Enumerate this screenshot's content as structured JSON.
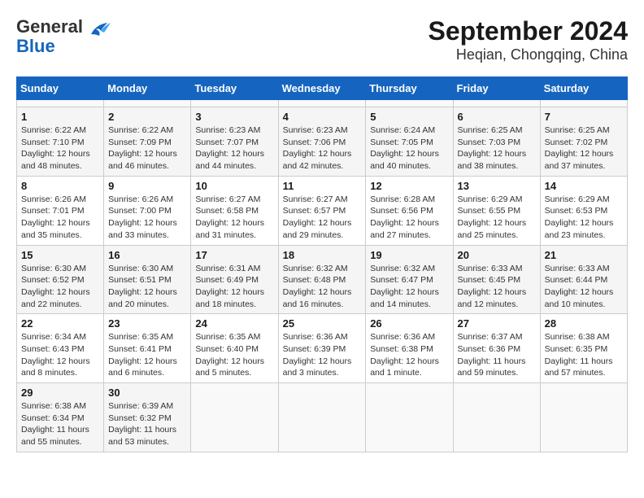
{
  "header": {
    "logo_general": "General",
    "logo_blue": "Blue",
    "title": "September 2024",
    "subtitle": "Heqian, Chongqing, China"
  },
  "calendar": {
    "days_of_week": [
      "Sunday",
      "Monday",
      "Tuesday",
      "Wednesday",
      "Thursday",
      "Friday",
      "Saturday"
    ],
    "weeks": [
      [
        {
          "day": "",
          "detail": ""
        },
        {
          "day": "",
          "detail": ""
        },
        {
          "day": "",
          "detail": ""
        },
        {
          "day": "",
          "detail": ""
        },
        {
          "day": "",
          "detail": ""
        },
        {
          "day": "",
          "detail": ""
        },
        {
          "day": "",
          "detail": ""
        }
      ],
      [
        {
          "day": "1",
          "detail": "Sunrise: 6:22 AM\nSunset: 7:10 PM\nDaylight: 12 hours\nand 48 minutes."
        },
        {
          "day": "2",
          "detail": "Sunrise: 6:22 AM\nSunset: 7:09 PM\nDaylight: 12 hours\nand 46 minutes."
        },
        {
          "day": "3",
          "detail": "Sunrise: 6:23 AM\nSunset: 7:07 PM\nDaylight: 12 hours\nand 44 minutes."
        },
        {
          "day": "4",
          "detail": "Sunrise: 6:23 AM\nSunset: 7:06 PM\nDaylight: 12 hours\nand 42 minutes."
        },
        {
          "day": "5",
          "detail": "Sunrise: 6:24 AM\nSunset: 7:05 PM\nDaylight: 12 hours\nand 40 minutes."
        },
        {
          "day": "6",
          "detail": "Sunrise: 6:25 AM\nSunset: 7:03 PM\nDaylight: 12 hours\nand 38 minutes."
        },
        {
          "day": "7",
          "detail": "Sunrise: 6:25 AM\nSunset: 7:02 PM\nDaylight: 12 hours\nand 37 minutes."
        }
      ],
      [
        {
          "day": "8",
          "detail": "Sunrise: 6:26 AM\nSunset: 7:01 PM\nDaylight: 12 hours\nand 35 minutes."
        },
        {
          "day": "9",
          "detail": "Sunrise: 6:26 AM\nSunset: 7:00 PM\nDaylight: 12 hours\nand 33 minutes."
        },
        {
          "day": "10",
          "detail": "Sunrise: 6:27 AM\nSunset: 6:58 PM\nDaylight: 12 hours\nand 31 minutes."
        },
        {
          "day": "11",
          "detail": "Sunrise: 6:27 AM\nSunset: 6:57 PM\nDaylight: 12 hours\nand 29 minutes."
        },
        {
          "day": "12",
          "detail": "Sunrise: 6:28 AM\nSunset: 6:56 PM\nDaylight: 12 hours\nand 27 minutes."
        },
        {
          "day": "13",
          "detail": "Sunrise: 6:29 AM\nSunset: 6:55 PM\nDaylight: 12 hours\nand 25 minutes."
        },
        {
          "day": "14",
          "detail": "Sunrise: 6:29 AM\nSunset: 6:53 PM\nDaylight: 12 hours\nand 23 minutes."
        }
      ],
      [
        {
          "day": "15",
          "detail": "Sunrise: 6:30 AM\nSunset: 6:52 PM\nDaylight: 12 hours\nand 22 minutes."
        },
        {
          "day": "16",
          "detail": "Sunrise: 6:30 AM\nSunset: 6:51 PM\nDaylight: 12 hours\nand 20 minutes."
        },
        {
          "day": "17",
          "detail": "Sunrise: 6:31 AM\nSunset: 6:49 PM\nDaylight: 12 hours\nand 18 minutes."
        },
        {
          "day": "18",
          "detail": "Sunrise: 6:32 AM\nSunset: 6:48 PM\nDaylight: 12 hours\nand 16 minutes."
        },
        {
          "day": "19",
          "detail": "Sunrise: 6:32 AM\nSunset: 6:47 PM\nDaylight: 12 hours\nand 14 minutes."
        },
        {
          "day": "20",
          "detail": "Sunrise: 6:33 AM\nSunset: 6:45 PM\nDaylight: 12 hours\nand 12 minutes."
        },
        {
          "day": "21",
          "detail": "Sunrise: 6:33 AM\nSunset: 6:44 PM\nDaylight: 12 hours\nand 10 minutes."
        }
      ],
      [
        {
          "day": "22",
          "detail": "Sunrise: 6:34 AM\nSunset: 6:43 PM\nDaylight: 12 hours\nand 8 minutes."
        },
        {
          "day": "23",
          "detail": "Sunrise: 6:35 AM\nSunset: 6:41 PM\nDaylight: 12 hours\nand 6 minutes."
        },
        {
          "day": "24",
          "detail": "Sunrise: 6:35 AM\nSunset: 6:40 PM\nDaylight: 12 hours\nand 5 minutes."
        },
        {
          "day": "25",
          "detail": "Sunrise: 6:36 AM\nSunset: 6:39 PM\nDaylight: 12 hours\nand 3 minutes."
        },
        {
          "day": "26",
          "detail": "Sunrise: 6:36 AM\nSunset: 6:38 PM\nDaylight: 12 hours\nand 1 minute."
        },
        {
          "day": "27",
          "detail": "Sunrise: 6:37 AM\nSunset: 6:36 PM\nDaylight: 11 hours\nand 59 minutes."
        },
        {
          "day": "28",
          "detail": "Sunrise: 6:38 AM\nSunset: 6:35 PM\nDaylight: 11 hours\nand 57 minutes."
        }
      ],
      [
        {
          "day": "29",
          "detail": "Sunrise: 6:38 AM\nSunset: 6:34 PM\nDaylight: 11 hours\nand 55 minutes."
        },
        {
          "day": "30",
          "detail": "Sunrise: 6:39 AM\nSunset: 6:32 PM\nDaylight: 11 hours\nand 53 minutes."
        },
        {
          "day": "",
          "detail": ""
        },
        {
          "day": "",
          "detail": ""
        },
        {
          "day": "",
          "detail": ""
        },
        {
          "day": "",
          "detail": ""
        },
        {
          "day": "",
          "detail": ""
        }
      ]
    ]
  }
}
